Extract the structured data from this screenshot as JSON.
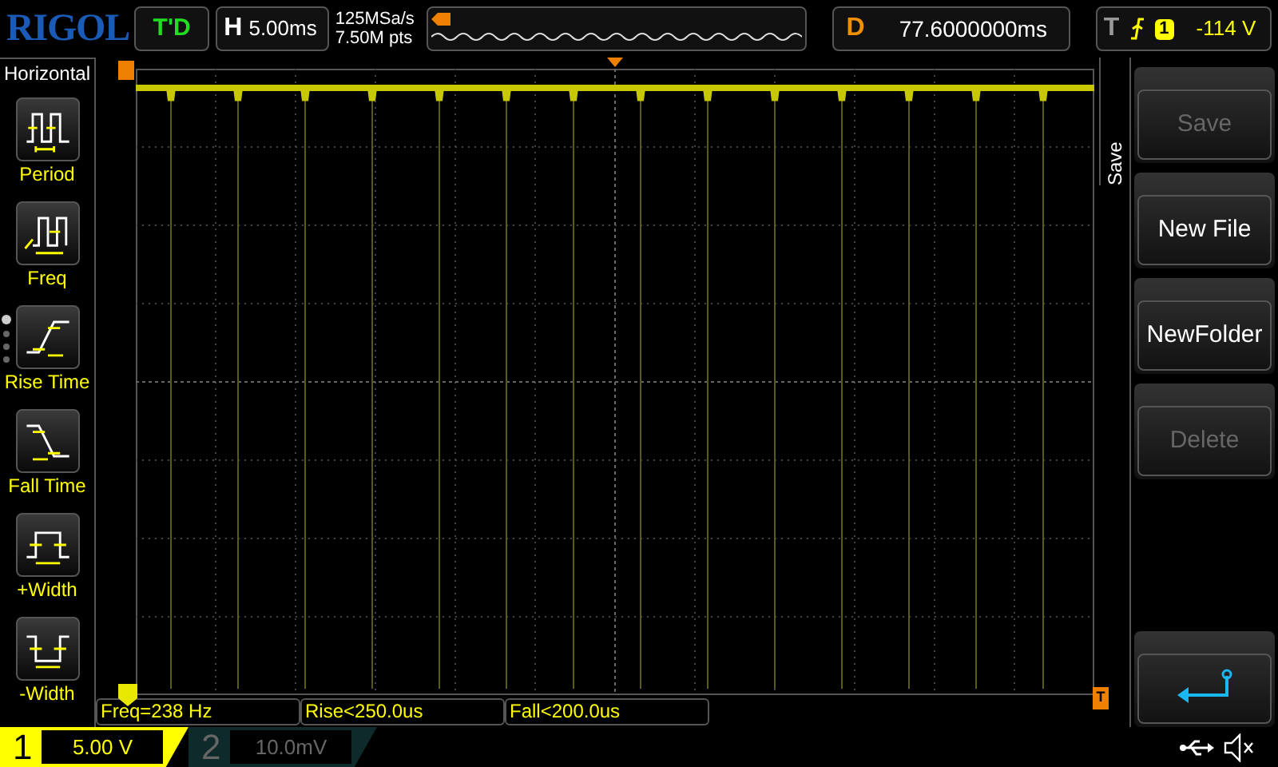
{
  "header": {
    "logo": "RIGOL",
    "run_status": "T'D",
    "horizontal": {
      "label": "H",
      "value": "5.00ms"
    },
    "sample_rate": "125MSa/s",
    "memory_depth": "7.50M pts",
    "delay": {
      "label": "D",
      "value": "77.6000000ms"
    },
    "trigger": {
      "label": "T",
      "source": "1",
      "level": "-114 V"
    }
  },
  "left_menu": {
    "title": "Horizontal",
    "items": [
      {
        "kind": "period",
        "label": "Period"
      },
      {
        "kind": "freq",
        "label": "Freq"
      },
      {
        "kind": "rise",
        "label": "Rise Time"
      },
      {
        "kind": "fall",
        "label": "Fall Time"
      },
      {
        "kind": "pwidth",
        "label": "+Width"
      },
      {
        "kind": "nwidth",
        "label": "-Width"
      }
    ],
    "pages": [
      {
        "selected": true
      },
      {
        "selected": false
      },
      {
        "selected": false
      },
      {
        "selected": false
      }
    ]
  },
  "trigger_level_marker": "T",
  "measurements": [
    "Freq=238 Hz",
    "Rise<250.0us",
    "Fall<200.0us"
  ],
  "right_menu": {
    "title": "Save",
    "buttons": [
      {
        "kind": "text",
        "label": "Save",
        "disabled": true
      },
      {
        "kind": "text",
        "label": "New File",
        "disabled": false
      },
      {
        "kind": "text",
        "label": "NewFolder",
        "disabled": false
      },
      {
        "kind": "text",
        "label": "Delete",
        "disabled": true
      },
      {
        "kind": "spacer"
      },
      {
        "kind": "return"
      }
    ]
  },
  "channels": [
    {
      "number": "1",
      "scale": "5.00 V",
      "active": true
    },
    {
      "number": "2",
      "scale": "10.0mV",
      "active": false
    }
  ]
}
